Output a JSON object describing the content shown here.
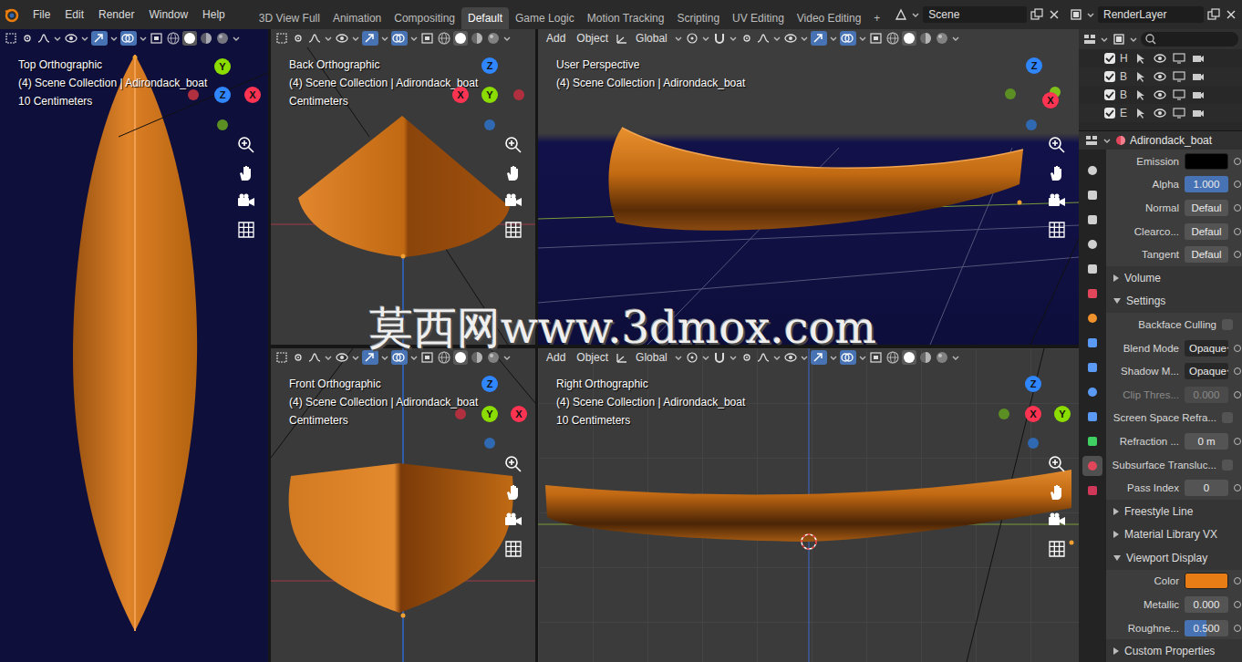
{
  "topbar": {
    "menu": [
      "File",
      "Edit",
      "Render",
      "Window",
      "Help"
    ],
    "workspaces": [
      {
        "label": "3D View Full",
        "selected": false
      },
      {
        "label": "Animation",
        "selected": false
      },
      {
        "label": "Compositing",
        "selected": false
      },
      {
        "label": "Default",
        "selected": true
      },
      {
        "label": "Game Logic",
        "selected": false
      },
      {
        "label": "Motion Tracking",
        "selected": false
      },
      {
        "label": "Scripting",
        "selected": false
      },
      {
        "label": "UV Editing",
        "selected": false
      },
      {
        "label": "Video Editing",
        "selected": false
      }
    ],
    "add_workspace": "+",
    "scene": "Scene",
    "render_layer": "RenderLayer"
  },
  "viewport_shading": [
    {
      "selected": false
    },
    {
      "selected": true
    },
    {
      "selected": false
    },
    {
      "selected": false
    }
  ],
  "header_toggles": [
    {
      "on": true
    },
    {
      "on": true
    }
  ],
  "viewports": [
    {
      "kind": "top",
      "menus": [],
      "lines": [
        "Top Orthographic",
        "(4) Scene Collection | Adirondack_boat",
        "10 Centimeters"
      ],
      "gizmo": [
        {
          "kind": "dot",
          "color": "#b0303f"
        },
        {
          "kind": "dot",
          "color": "#5b8e23"
        },
        {
          "kind": "axis",
          "label": "Z",
          "color": "#2f86ff"
        },
        {
          "kind": "axis",
          "label": "Y",
          "color": "#8bdc00"
        },
        {
          "kind": "axis",
          "label": "X",
          "color": "#ff3352"
        }
      ]
    },
    {
      "kind": "back",
      "menus": [],
      "lines": [
        "Back Orthographic",
        "(4) Scene Collection | Adirondack_boat",
        "Centimeters"
      ],
      "gizmo": [
        {
          "kind": "dot",
          "color": "#b0303f"
        },
        {
          "kind": "dot",
          "color": "#2f69b1"
        },
        {
          "kind": "axis",
          "label": "Y",
          "color": "#8bdc00"
        },
        {
          "kind": "axis",
          "label": "Z",
          "color": "#2f86ff"
        },
        {
          "kind": "axis",
          "label": "X",
          "color": "#ff3352"
        }
      ]
    },
    {
      "kind": "perspective",
      "menus": [
        "Add",
        "Object"
      ],
      "orientation": "Global",
      "lines": [
        "User Perspective",
        "(4) Scene Collection | Adirondack_boat"
      ],
      "gizmo": [
        {
          "kind": "dot",
          "color": "#5b8e23"
        },
        {
          "kind": "dot",
          "color": "#2f69b1"
        },
        {
          "kind": "dot",
          "color": "#7fbf1a"
        },
        {
          "kind": "axis",
          "label": "X",
          "color": "#ff3352"
        },
        {
          "kind": "axis",
          "label": "Z",
          "color": "#2f86ff"
        }
      ]
    },
    {
      "kind": "front",
      "menus": [],
      "lines": [
        "Front Orthographic",
        "(4) Scene Collection | Adirondack_boat",
        "Centimeters"
      ],
      "gizmo": [
        {
          "kind": "dot",
          "color": "#b0303f"
        },
        {
          "kind": "dot",
          "color": "#2f69b1"
        },
        {
          "kind": "axis",
          "label": "Y",
          "color": "#8bdc00"
        },
        {
          "kind": "axis",
          "label": "Z",
          "color": "#2f86ff"
        },
        {
          "kind": "axis",
          "label": "X",
          "color": "#ff3352"
        }
      ]
    },
    {
      "kind": "right",
      "menus": [
        "Add",
        "Object"
      ],
      "orientation": "Global",
      "lines": [
        "Right Orthographic",
        "(4) Scene Collection | Adirondack_boat",
        "10 Centimeters"
      ],
      "gizmo": [
        {
          "kind": "dot",
          "color": "#5b8e23"
        },
        {
          "kind": "dot",
          "color": "#2f69b1"
        },
        {
          "kind": "axis",
          "label": "X",
          "color": "#ff3352"
        },
        {
          "kind": "axis",
          "label": "Z",
          "color": "#2f86ff"
        },
        {
          "kind": "axis",
          "label": "Y",
          "color": "#8bdc00"
        }
      ]
    }
  ],
  "outliner": {
    "rows": [
      {
        "letter": "H",
        "checked": true
      },
      {
        "letter": "B",
        "checked": true
      },
      {
        "letter": "B",
        "checked": true
      },
      {
        "letter": "E",
        "checked": true
      }
    ]
  },
  "properties": {
    "object": "Adirondack_boat",
    "tabs": [
      {
        "selected": false,
        "color": "#cfcfcf"
      },
      {
        "selected": false,
        "color": "#cfcfcf"
      },
      {
        "selected": false,
        "color": "#cfcfcf"
      },
      {
        "selected": false,
        "color": "#cfcfcf"
      },
      {
        "selected": false,
        "color": "#cfcfcf"
      },
      {
        "selected": false,
        "color": "#e2465a"
      },
      {
        "selected": false,
        "color": "#f0922c"
      },
      {
        "selected": false,
        "color": "#5a9af5"
      },
      {
        "selected": false,
        "color": "#5a9af5"
      },
      {
        "selected": false,
        "color": "#5a9af5"
      },
      {
        "selected": false,
        "color": "#5a9af5"
      },
      {
        "selected": false,
        "color": "#3fcf63"
      },
      {
        "selected": true,
        "color": "#e2465a"
      },
      {
        "selected": false,
        "color": "#d0385a"
      }
    ],
    "rows": [
      {
        "kind": "color",
        "label": "Emission",
        "color": "#000000",
        "disabled": false
      },
      {
        "kind": "slider",
        "label": "Alpha",
        "value": "1.000",
        "level": 1,
        "disabled": false
      },
      {
        "kind": "field",
        "label": "Normal",
        "value": "Defaul",
        "disabled": false
      },
      {
        "kind": "field",
        "label": "Clearco...",
        "value": "Defaul",
        "disabled": false
      },
      {
        "kind": "field",
        "label": "Tangent",
        "value": "Defaul",
        "disabled": false
      },
      {
        "kind": "section",
        "label": "Volume",
        "expanded": false,
        "disabled": false
      },
      {
        "kind": "section",
        "label": "Settings",
        "expanded": true,
        "disabled": false
      },
      {
        "kind": "check",
        "label": "Backface Culling",
        "checked": false,
        "disabled": false
      },
      {
        "kind": "dropdown",
        "label": "Blend Mode",
        "value": "Opaque",
        "disabled": false
      },
      {
        "kind": "dropdown",
        "label": "Shadow M...",
        "value": "Opaque",
        "disabled": false
      },
      {
        "kind": "field",
        "label": "Clip Thres...",
        "value": "0.000",
        "disabled": true
      },
      {
        "kind": "check",
        "label": "Screen Space Refra...",
        "checked": false,
        "disabled": false
      },
      {
        "kind": "field",
        "label": "Refraction ...",
        "value": "0 m",
        "disabled": false
      },
      {
        "kind": "check",
        "label": "Subsurface Transluc...",
        "checked": false,
        "disabled": false
      },
      {
        "kind": "field",
        "label": "Pass Index",
        "value": "0",
        "disabled": false
      },
      {
        "kind": "section",
        "label": "Freestyle Line",
        "expanded": false,
        "disabled": false
      },
      {
        "kind": "section",
        "label": "Material Library VX",
        "expanded": false,
        "disabled": false
      },
      {
        "kind": "section",
        "label": "Viewport Display",
        "expanded": true,
        "disabled": false
      },
      {
        "kind": "color",
        "label": "Color",
        "color": "#e87d16",
        "disabled": false
      },
      {
        "kind": "slider",
        "label": "Metallic",
        "value": "0.000",
        "level": 0,
        "disabled": false
      },
      {
        "kind": "slider",
        "label": "Roughne...",
        "value": "0.500",
        "level": 0.5,
        "disabled": false
      },
      {
        "kind": "section",
        "label": "Custom Properties",
        "expanded": false,
        "disabled": false
      }
    ]
  },
  "watermark": "莫西网www.3dmox.com"
}
